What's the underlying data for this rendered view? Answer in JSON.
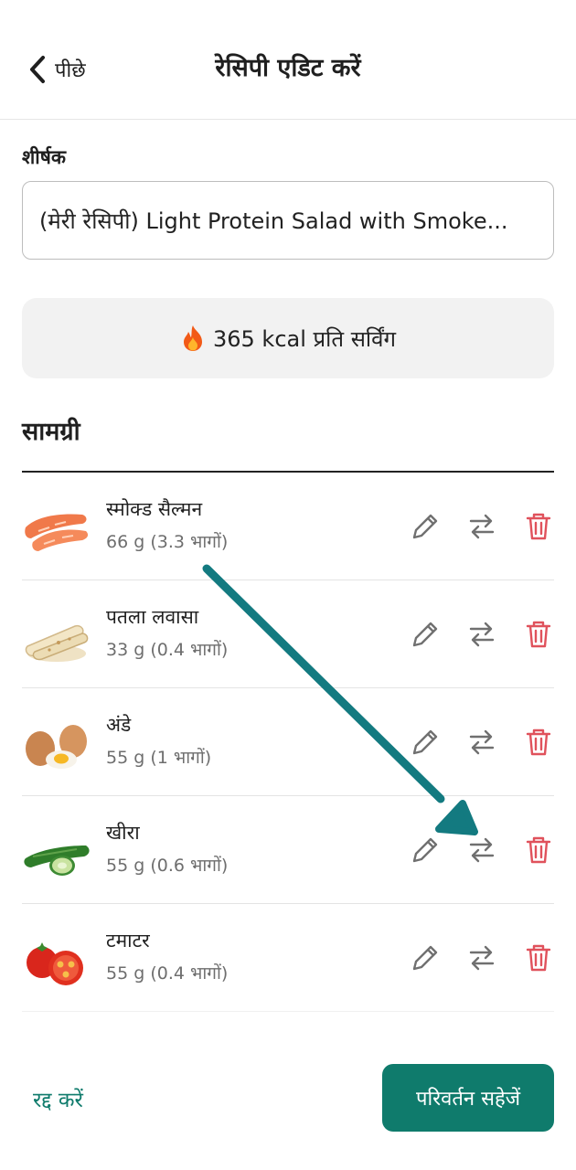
{
  "header": {
    "back_label": "पीछे",
    "title": "रेसिपी एडिट करें"
  },
  "recipe": {
    "title_label": "शीर्षक",
    "title_value": "(मेरी रेसिपी) Light Protein Salad with Smoke...",
    "kcal_text": "365 kcal प्रति सर्विंग",
    "kcal_icon": "fire-icon"
  },
  "ingredients": {
    "heading": "सामग्री",
    "items": [
      {
        "name": "स्मोक्ड सैल्मन",
        "qty": "66 g (3.3 भागों)",
        "icon": "salmon-image"
      },
      {
        "name": "पतला लवासा",
        "qty": "33 g (0.4 भागों)",
        "icon": "lavash-image"
      },
      {
        "name": "अंडे",
        "qty": "55 g (1 भागों)",
        "icon": "eggs-image"
      },
      {
        "name": "खीरा",
        "qty": "55 g (0.6 भागों)",
        "icon": "cucumber-image"
      },
      {
        "name": "टमाटर",
        "qty": "55 g (0.4 भागों)",
        "icon": "tomato-image"
      }
    ],
    "action_icons": [
      "edit-pencil-icon",
      "swap-arrows-icon",
      "delete-trash-icon"
    ]
  },
  "footer": {
    "cancel_label": "रद्द करें",
    "save_label": "परिवर्तन सहेजें"
  },
  "colors": {
    "accent": "#0f7b6c",
    "delete": "#e0525c",
    "icon_gray": "#707070",
    "annotation_arrow": "#137a80"
  }
}
